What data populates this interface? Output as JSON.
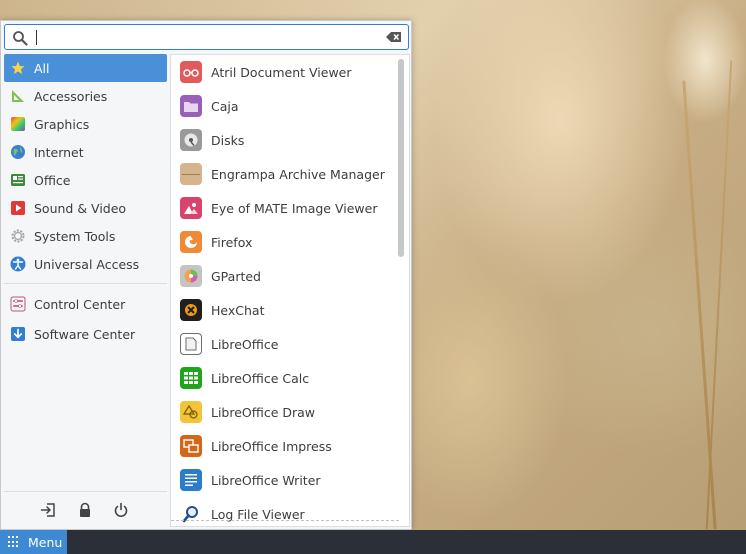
{
  "search": {
    "placeholder": "",
    "value": ""
  },
  "categories": [
    {
      "label": "All",
      "icon": "star-icon",
      "active": true
    },
    {
      "label": "Accessories",
      "icon": "accessories-icon"
    },
    {
      "label": "Graphics",
      "icon": "graphics-icon"
    },
    {
      "label": "Internet",
      "icon": "globe-icon"
    },
    {
      "label": "Office",
      "icon": "office-icon"
    },
    {
      "label": "Sound & Video",
      "icon": "multimedia-icon"
    },
    {
      "label": "System Tools",
      "icon": "gear-icon"
    },
    {
      "label": "Universal Access",
      "icon": "accessibility-icon"
    }
  ],
  "system_items": [
    {
      "label": "Control Center",
      "icon": "control-center-icon"
    },
    {
      "label": "Software Center",
      "icon": "software-center-icon"
    }
  ],
  "apps": [
    {
      "label": "Atril Document Viewer",
      "icon": "atril-icon",
      "color": "#d9534f"
    },
    {
      "label": "Caja",
      "icon": "folder-icon",
      "color": "#9b59b6"
    },
    {
      "label": "Disks",
      "icon": "disks-icon",
      "color": "#8e8e8e"
    },
    {
      "label": "Engrampa Archive Manager",
      "icon": "archive-icon",
      "color": "#c8a279"
    },
    {
      "label": "Eye of MATE Image Viewer",
      "icon": "image-viewer-icon",
      "color": "#d6456b"
    },
    {
      "label": "Firefox",
      "icon": "firefox-icon",
      "color": "#f07a2b"
    },
    {
      "label": "GParted",
      "icon": "gparted-icon",
      "color": "#b8b8b8"
    },
    {
      "label": "HexChat",
      "icon": "hexchat-icon",
      "color": "#1e1e1e"
    },
    {
      "label": "LibreOffice",
      "icon": "libreoffice-icon",
      "color": "#6d6d6d"
    },
    {
      "label": "LibreOffice Calc",
      "icon": "calc-icon",
      "color": "#18a303"
    },
    {
      "label": "LibreOffice Draw",
      "icon": "draw-icon",
      "color": "#e4b62b"
    },
    {
      "label": "LibreOffice Impress",
      "icon": "impress-icon",
      "color": "#d0620d"
    },
    {
      "label": "LibreOffice Writer",
      "icon": "writer-icon",
      "color": "#2a7ac8"
    },
    {
      "label": "Log File Viewer",
      "icon": "log-viewer-icon",
      "color": "#1f4f8c"
    }
  ],
  "bottom_actions": [
    {
      "name": "logout-icon"
    },
    {
      "name": "lock-icon"
    },
    {
      "name": "power-icon"
    }
  ],
  "taskbar": {
    "menu_label": "Menu"
  },
  "colors": {
    "accent": "#4a90d9",
    "taskbar": "#2b3038",
    "menu_button": "#3d89d4"
  }
}
